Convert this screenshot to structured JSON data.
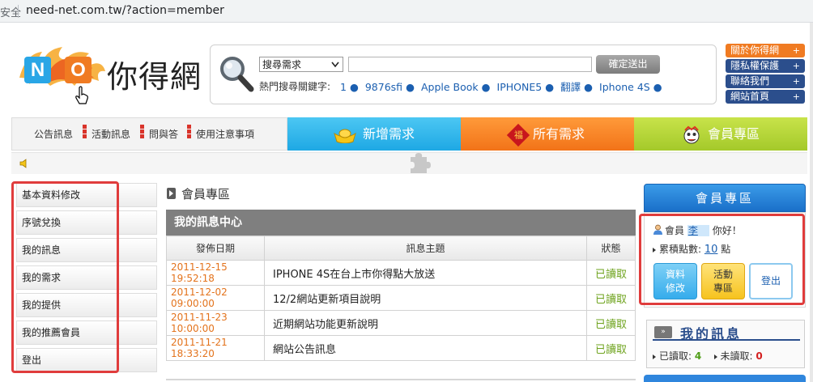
{
  "browser": {
    "secure_label": "安全",
    "url": "need-net.com.tw/?action=member"
  },
  "logo": {
    "n": "N",
    "o": "O",
    "text": "你得網"
  },
  "search": {
    "select_value": "搜尋需求",
    "input_value": "",
    "submit_label": "確定送出",
    "hot_label": "熱門搜尋關鍵字:",
    "hot_keywords": [
      "1",
      "9876sfi",
      "Apple Book",
      "IPHONE5",
      "翻譯",
      "Iphone 4S"
    ]
  },
  "side_menu": [
    {
      "label": "關於你得網",
      "plus": "+",
      "color": "#f07b22"
    },
    {
      "label": "隱私權保護",
      "plus": "+",
      "color": "#2b4e8c"
    },
    {
      "label": "聯絡我們",
      "plus": "+",
      "color": "#2b4e8c"
    },
    {
      "label": "網站首頁",
      "plus": "+",
      "color": "#2b4e8c"
    }
  ],
  "nav": {
    "links": [
      "公告訊息",
      "活動訊息",
      "問與答",
      "使用注意事項"
    ],
    "tabs": [
      {
        "label": "新增需求",
        "icon": "gold-ingot-icon"
      },
      {
        "label": "所有需求",
        "icon": "fortune-icon",
        "icon_char": "福"
      },
      {
        "label": "會員專區",
        "icon": "lion-dance-icon"
      }
    ]
  },
  "left_menu": [
    "基本資料修改",
    "序號兌換",
    "我的訊息",
    "我的需求",
    "我的提供",
    "我的推薦會員",
    "登出"
  ],
  "main": {
    "section_title": "會員專區",
    "message_center": {
      "title": "我的訊息中心",
      "columns": [
        "發佈日期",
        "訊息主題",
        "狀態"
      ],
      "rows": [
        {
          "date": "2011-12-15 19:52:18",
          "subject": "IPHONE 4S在台上市你得點大放送",
          "status": "已讀取"
        },
        {
          "date": "2011-12-02 09:00:00",
          "subject": "12/2網站更新項目說明",
          "status": "已讀取"
        },
        {
          "date": "2011-11-23 10:00:00",
          "subject": "近期網站功能更新說明",
          "status": "已讀取"
        },
        {
          "date": "2011-11-21 18:33:20",
          "subject": "網站公告訊息",
          "status": "已讀取"
        }
      ]
    }
  },
  "member_panel": {
    "title": "會員專區",
    "greet_prefix": "會員",
    "name": "李",
    "greet_suffix": "你好！",
    "points_label": "累積點數:",
    "points_value": "10",
    "points_unit": "點",
    "buttons": {
      "edit_line1": "資料",
      "edit_line2": "修改",
      "event_line1": "活動",
      "event_line2": "專區",
      "logout": "登出"
    }
  },
  "my_messages": {
    "badge": "»",
    "title": "我的訊息",
    "read_label": "已讀取:",
    "read_count": "4",
    "unread_label": "未讀取:",
    "unread_count": "0"
  },
  "colors": {
    "accent_blue": "#29a6e6",
    "accent_orange": "#f07b22",
    "accent_green": "#a4c92a",
    "highlight_red": "#e03c3c"
  }
}
